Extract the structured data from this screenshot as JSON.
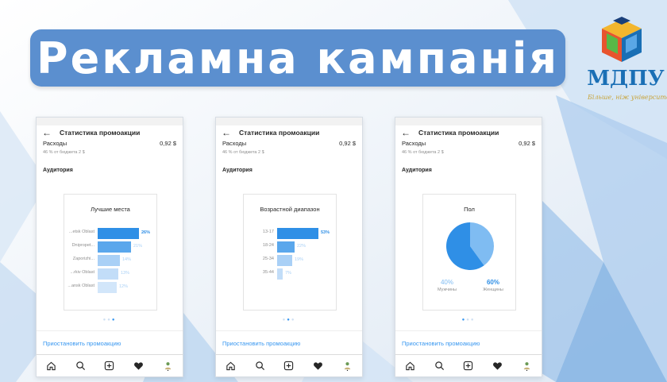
{
  "slide": {
    "title": "Рекламна кампанія",
    "logo": {
      "name": "МДПУ",
      "slogan": "Більше, ніж університет!",
      "colors": {
        "primary": "#1a6fb5",
        "accent_yellow": "#f3b62e",
        "accent_red": "#e8542e",
        "accent_green": "#59b947"
      }
    },
    "banner_color": "#5b8fcf"
  },
  "phones": [
    {
      "header": "Статистика промоакции",
      "spend_label": "Расходы",
      "spend_value": "0,92 $",
      "budget_note": "46 % от бюджета 2 $",
      "audience_label": "Аудитория",
      "card_title": "Лучшие места",
      "chart_data": {
        "type": "bar",
        "categories": [
          "...etsk Oblast",
          "Dnipropet...",
          "Zaporizhi...",
          "...rkiv Oblast",
          "...ansk Oblast"
        ],
        "values": [
          26,
          21,
          14,
          13,
          12
        ],
        "value_labels": [
          "26%",
          "21%",
          "14%",
          "13%",
          "12%"
        ],
        "orientation": "horizontal"
      },
      "dots_active": 2,
      "pause_link": "Приостановить промоакцию"
    },
    {
      "header": "Статистика промоакции",
      "spend_label": "Расходы",
      "spend_value": "0,92 $",
      "budget_note": "46 % от бюджета 2 $",
      "audience_label": "Аудитория",
      "card_title": "Возрастной диапазон",
      "chart_data": {
        "type": "bar",
        "categories": [
          "13-17",
          "18-24",
          "25-34",
          "35-44"
        ],
        "values": [
          53,
          22,
          19,
          7
        ],
        "value_labels": [
          "53%",
          "22%",
          "19%",
          "7%"
        ],
        "orientation": "horizontal"
      },
      "dots_active": 1,
      "pause_link": "Приостановить промоакцию"
    },
    {
      "header": "Статистика промоакции",
      "spend_label": "Расходы",
      "spend_value": "0,92 $",
      "budget_note": "46 % от бюджета 2 $",
      "audience_label": "Аудитория",
      "card_title": "Пол",
      "chart_data": {
        "type": "pie",
        "categories": [
          "Мужчины",
          "Женщины"
        ],
        "values": [
          40,
          60
        ],
        "value_labels": [
          "40%",
          "60%"
        ],
        "colors": [
          "#7fbcf2",
          "#2f8fe6"
        ]
      },
      "dots_active": 0,
      "pause_link": "Приостановить промоакцию"
    }
  ],
  "nav_icons": [
    "home-icon",
    "search-icon",
    "add-icon",
    "heart-icon",
    "profile-icon"
  ]
}
